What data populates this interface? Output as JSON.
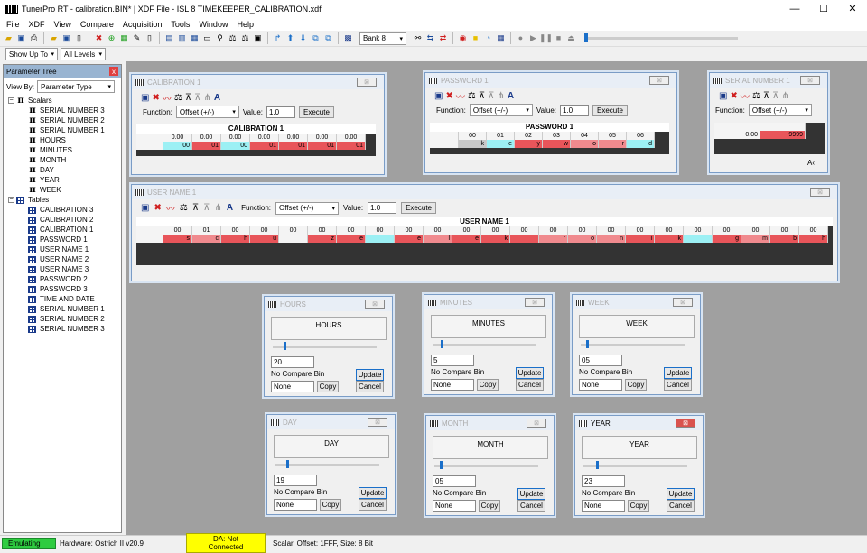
{
  "app": {
    "title": "TunerPro RT - calibration.BIN* | XDF File - ISL 8 TIMEKEEPER_CALIBRATION.xdf",
    "min": "—",
    "max": "☐",
    "close": "✕"
  },
  "menu": [
    "File",
    "XDF",
    "View",
    "Compare",
    "Acquisition",
    "Tools",
    "Window",
    "Help"
  ],
  "toolbar": {
    "bank": "Bank 8"
  },
  "toolbar2": {
    "show": "Show Up To",
    "levels": "All Levels"
  },
  "tree": {
    "title": "Parameter Tree",
    "close": "x",
    "view_by_label": "View By:",
    "view_by": "Parameter Type",
    "scalars_label": "Scalars",
    "scalars": [
      "SERIAL NUMBER 3",
      "SERIAL NUMBER 2",
      "SERIAL NUMBER 1",
      "HOURS",
      "MINUTES",
      "MONTH",
      "DAY",
      "YEAR",
      "WEEK"
    ],
    "tables_label": "Tables",
    "tables": [
      "CALIBRATION 3",
      "CALIBRATION 2",
      "CALIBRATION 1",
      "PASSWORD 1",
      "USER NAME 1",
      "USER NAME 2",
      "USER NAME 3",
      "PASSWORD 2",
      "PASSWORD 3",
      "TIME AND DATE",
      "SERIAL NUMBER 1",
      "SERIAL NUMBER 2",
      "SERIAL NUMBER 3"
    ]
  },
  "common": {
    "function_label": "Function:",
    "function": "Offset (+/-)",
    "value_label": "Value:",
    "value": "1.0",
    "execute": "Execute",
    "font_glyph": "A",
    "no_compare": "No Compare Bin",
    "none": "None",
    "copy": "Copy",
    "update": "Update",
    "cancel": "Cancel",
    "close": "⊠"
  },
  "calibration1": {
    "title": "CALIBRATION 1",
    "name": "CALIBRATION 1",
    "headers": [
      "0.00",
      "0.00",
      "0.00",
      "0.00",
      "0.00",
      "0.00",
      "0.00"
    ],
    "values": [
      "00",
      "01",
      "00",
      "01",
      "01",
      "01",
      "01"
    ]
  },
  "password1": {
    "title": "PASSWORD 1",
    "name": "PASSWORD 1",
    "headers": [
      "00",
      "01",
      "02",
      "03",
      "04",
      "05",
      "06"
    ],
    "values": [
      "k",
      "e",
      "y",
      "w",
      "o",
      "r",
      "d"
    ]
  },
  "serial1": {
    "title": "SERIAL NUMBER 1",
    "row_label": "0.00",
    "value": "9999",
    "corner": "A‹"
  },
  "username1": {
    "title": "USER NAME 1",
    "name": "USER NAME 1",
    "headers": [
      "00",
      "01",
      "00",
      "00",
      "00",
      "00",
      "00",
      "00",
      "00",
      "00",
      "00",
      "00",
      "00",
      "00",
      "00",
      "00",
      "00",
      "00",
      "00",
      "00",
      "00",
      "00",
      "00",
      "00",
      "00",
      "00",
      "00"
    ],
    "values": [
      "s",
      "c",
      "h",
      "u",
      "",
      "z",
      "e",
      "",
      "e",
      "l",
      "e",
      "k",
      "",
      "r",
      "o",
      "n",
      "i",
      "k",
      "",
      "g",
      "m",
      "b",
      "h"
    ]
  },
  "scalars": {
    "hours": {
      "title": "HOURS",
      "name": "HOURS",
      "value": "20",
      "slider": 0.1
    },
    "minutes": {
      "title": "MINUTES",
      "name": "MINUTES",
      "value": "5",
      "slider": 0.08
    },
    "week": {
      "title": "WEEK",
      "name": "WEEK",
      "value": "05",
      "slider": 0.05
    },
    "day": {
      "title": "DAY",
      "name": "DAY",
      "value": "19",
      "slider": 0.1
    },
    "month": {
      "title": "MONTH",
      "name": "MONTH",
      "value": "05",
      "slider": 0.05
    },
    "year": {
      "title": "YEAR",
      "name": "YEAR",
      "value": "23",
      "slider": 0.12
    }
  },
  "status": {
    "emulating": "Emulating",
    "hardware": "Hardware: Ostrich II v20.9",
    "da": "DA: Not Connected",
    "info": "Scalar, Offset: 1FFF,  Size: 8 Bit"
  }
}
